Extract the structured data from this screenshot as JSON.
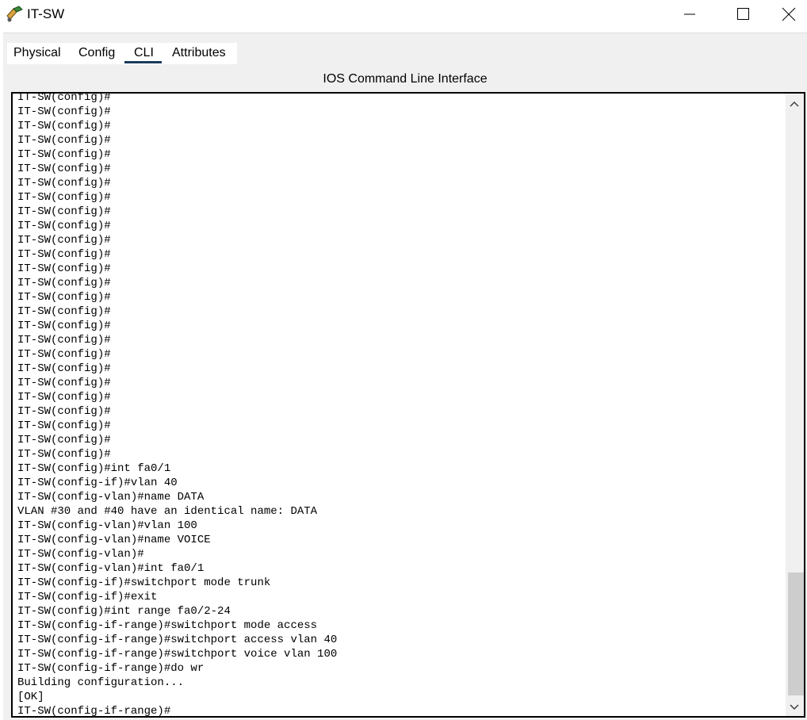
{
  "window": {
    "title": "IT-SW",
    "icon": "packet-tracer-switch-icon"
  },
  "tabs": [
    {
      "label": "Physical"
    },
    {
      "label": "Config"
    },
    {
      "label": "CLI",
      "active": true
    },
    {
      "label": "Attributes"
    }
  ],
  "cli": {
    "heading": "IOS Command Line Interface",
    "lines": [
      "IT-SW(config)#",
      "IT-SW(config)#",
      "IT-SW(config)#",
      "IT-SW(config)#",
      "IT-SW(config)#",
      "IT-SW(config)#",
      "IT-SW(config)#",
      "IT-SW(config)#",
      "IT-SW(config)#",
      "IT-SW(config)#",
      "IT-SW(config)#",
      "IT-SW(config)#",
      "IT-SW(config)#",
      "IT-SW(config)#",
      "IT-SW(config)#",
      "IT-SW(config)#",
      "IT-SW(config)#",
      "IT-SW(config)#",
      "IT-SW(config)#",
      "IT-SW(config)#",
      "IT-SW(config)#",
      "IT-SW(config)#",
      "IT-SW(config)#",
      "IT-SW(config)#",
      "IT-SW(config)#",
      "IT-SW(config)#",
      "IT-SW(config)#int fa0/1",
      "IT-SW(config-if)#vlan 40",
      "IT-SW(config-vlan)#name DATA",
      "VLAN #30 and #40 have an identical name: DATA",
      "IT-SW(config-vlan)#vlan 100",
      "IT-SW(config-vlan)#name VOICE",
      "IT-SW(config-vlan)#",
      "IT-SW(config-vlan)#int fa0/1",
      "IT-SW(config-if)#switchport mode trunk",
      "IT-SW(config-if)#exit",
      "IT-SW(config)#int range fa0/2-24",
      "IT-SW(config-if-range)#switchport mode access",
      "IT-SW(config-if-range)#switchport access vlan 40",
      "IT-SW(config-if-range)#switchport voice vlan 100",
      "IT-SW(config-if-range)#do wr",
      "Building configuration...",
      "[OK]",
      "IT-SW(config-if-range)#"
    ]
  }
}
